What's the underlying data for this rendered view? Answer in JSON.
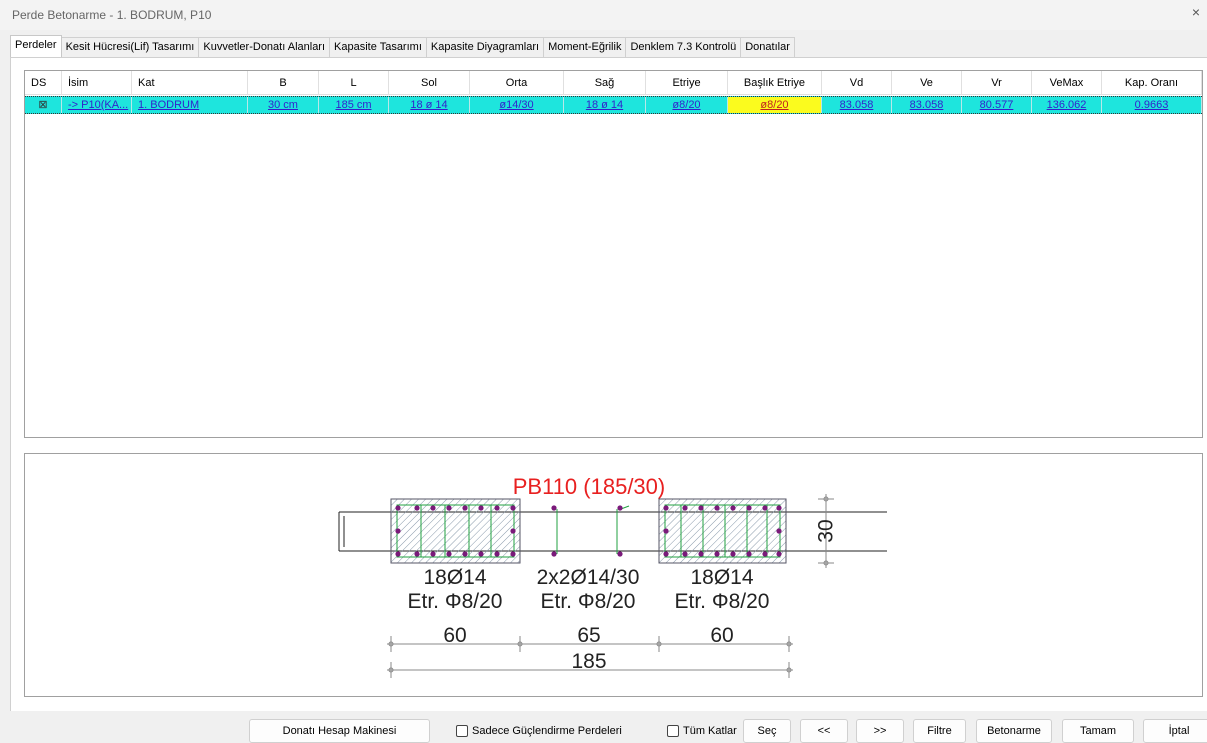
{
  "window": {
    "title": "Perde Betonarme - 1. BODRUM, P10",
    "close_glyph": "×"
  },
  "tabs": [
    "Perdeler",
    "Kesit Hücresi(Lif) Tasarımı",
    "Kuvvetler-Donatı Alanları",
    "Kapasite Tasarımı",
    "Kapasite Diyagramları",
    "Moment-Eğrilik",
    "Denklem 7.3 Kontrolü",
    "Donatılar"
  ],
  "grid": {
    "headers": [
      "DS",
      "İsim",
      "Kat",
      "B",
      "L",
      "Sol",
      "Orta",
      "Sağ",
      "Etriye",
      "Başlık Etriye",
      "Vd",
      "Ve",
      "Vr",
      "VeMax",
      "Kap. Oranı"
    ],
    "row": {
      "ds": "⊠",
      "isim": "-> P10(KA...",
      "kat": "1. BODRUM",
      "b": "30 cm",
      "l": "185 cm",
      "sol": "18 ø 14",
      "orta": "ø14/30",
      "sag": "18 ø 14",
      "etriye": "ø8/20",
      "baslik_etriye": "ø8/20",
      "vd": "83.058",
      "ve": "83.058",
      "vr": "80.577",
      "vemax": "136.062",
      "kap_orani": "0.9663"
    }
  },
  "drawing": {
    "title": "PB110 (185/30)",
    "left_rebar": "18Ø14",
    "left_stirrup": "Etr. Φ8/20",
    "mid_rebar": "2x2Ø14/30",
    "mid_stirrup": "Etr. Φ8/20",
    "right_rebar": "18Ø14",
    "right_stirrup": "Etr. Φ8/20",
    "dim_left": "60",
    "dim_mid": "65",
    "dim_right": "60",
    "dim_total": "185",
    "dim_height": "30",
    "colors": {
      "title": "#e82020",
      "bar": "#7a1a7a",
      "stirrup": "#20a040",
      "hatch": "#8899aa"
    }
  },
  "bottom": {
    "calc_button": "Donatı Hesap Makinesi",
    "only_strengthen": "Sadece Güçlendirme Perdeleri",
    "all_floors": "Tüm Katlar",
    "select_button": "Seç",
    "prev_button": "<<",
    "next_button": ">>",
    "filter_button": "Filtre",
    "concrete_button": "Betonarme",
    "ok_button": "Tamam",
    "cancel_button": "İptal"
  }
}
